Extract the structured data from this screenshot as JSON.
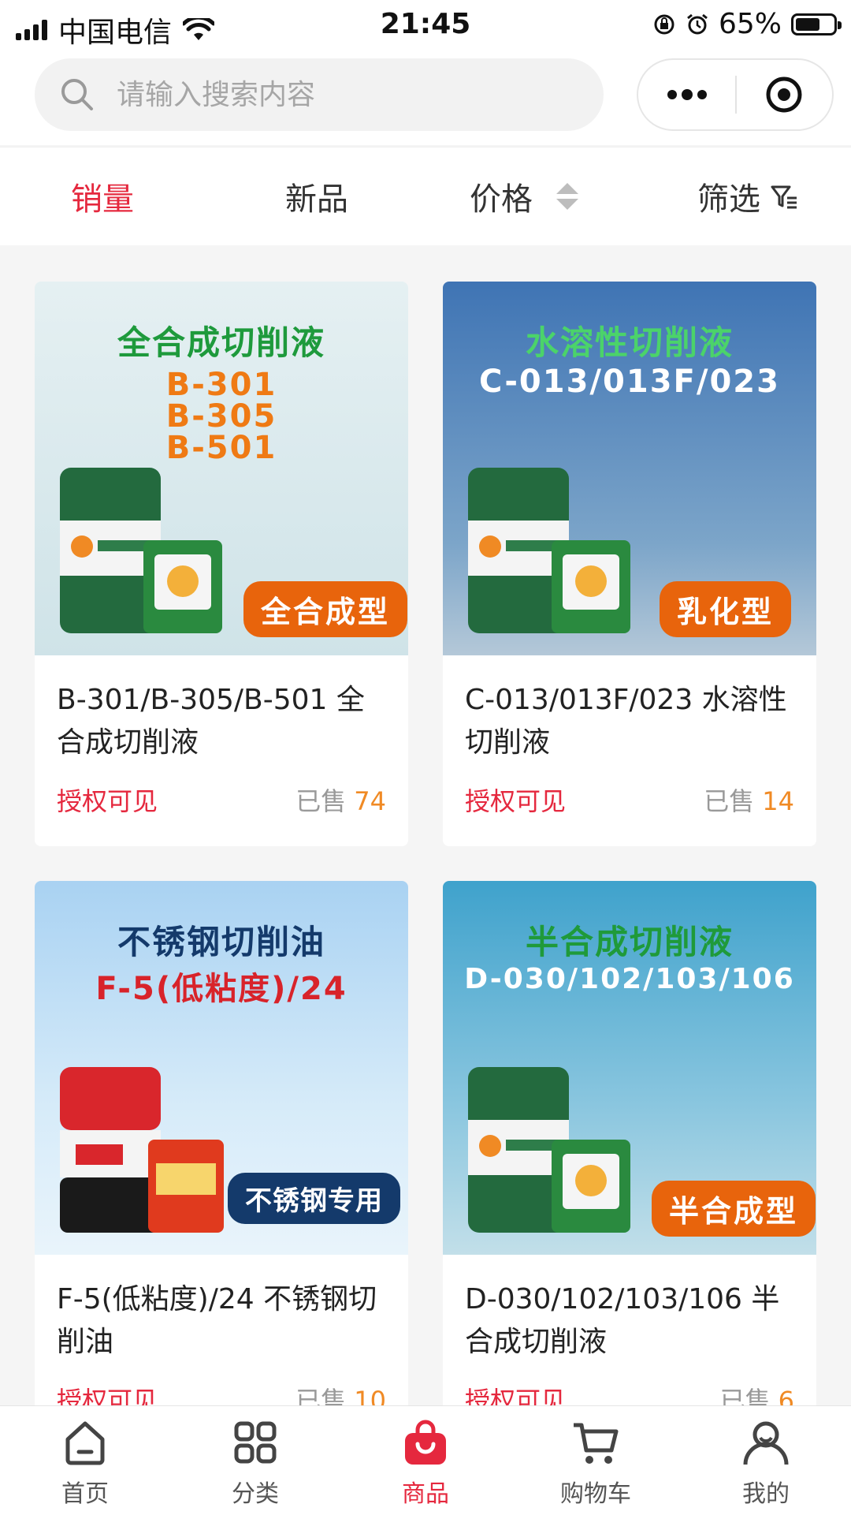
{
  "status_bar": {
    "carrier": "中国电信",
    "time": "21:45",
    "battery_text": "65%",
    "battery_level": 0.65
  },
  "search": {
    "placeholder": "请输入搜索内容",
    "icon": "search-icon"
  },
  "capsule": {
    "more_icon": "more-dots-icon",
    "close_icon": "target-close-icon"
  },
  "sort_tabs": [
    {
      "label": "销量",
      "active": true
    },
    {
      "label": "新品",
      "active": false
    },
    {
      "label": "价格",
      "active": false
    },
    {
      "label": "筛选",
      "active": false
    }
  ],
  "products": [
    {
      "image_title": "全合成切削液",
      "image_codes": [
        "B-301",
        "B-305",
        "B-501"
      ],
      "image_badge": "全合成型",
      "name": "B-301/B-305/B-501 全合成切削液",
      "price_text": "授权可见",
      "sold_label": "已售",
      "sold_count": "74"
    },
    {
      "image_title": "水溶性切削液",
      "image_codes": [
        "C-013/013F/023"
      ],
      "image_badge": "乳化型",
      "name": "C-013/013F/023 水溶性切削液",
      "price_text": "授权可见",
      "sold_label": "已售",
      "sold_count": "14"
    },
    {
      "image_title": "不锈钢切削油",
      "image_codes": [
        "F-5(低粘度)/24"
      ],
      "image_badge": "不锈钢专用",
      "name": "F-5(低粘度)/24 不锈钢切削油",
      "price_text": "授权可见",
      "sold_label": "已售",
      "sold_count": "10"
    },
    {
      "image_title": "半合成切削液",
      "image_codes": [
        "D-030/102/103/106"
      ],
      "image_badge": "半合成型",
      "name": "D-030/102/103/106 半合成切削液",
      "price_text": "授权可见",
      "sold_label": "已售",
      "sold_count": "6"
    }
  ],
  "tab_bar": [
    {
      "label": "首页",
      "icon": "home-icon",
      "active": false
    },
    {
      "label": "分类",
      "icon": "category-icon",
      "active": false
    },
    {
      "label": "商品",
      "icon": "shopping-bag-icon",
      "active": true
    },
    {
      "label": "购物车",
      "icon": "cart-icon",
      "active": false
    },
    {
      "label": "我的",
      "icon": "user-icon",
      "active": false
    }
  ],
  "colors": {
    "accent": "#e5283e",
    "sold_count": "#f08a24",
    "badge_orange": "#e8640c",
    "badge_navy": "#143a6b",
    "title_green": "#1e9a3c"
  }
}
